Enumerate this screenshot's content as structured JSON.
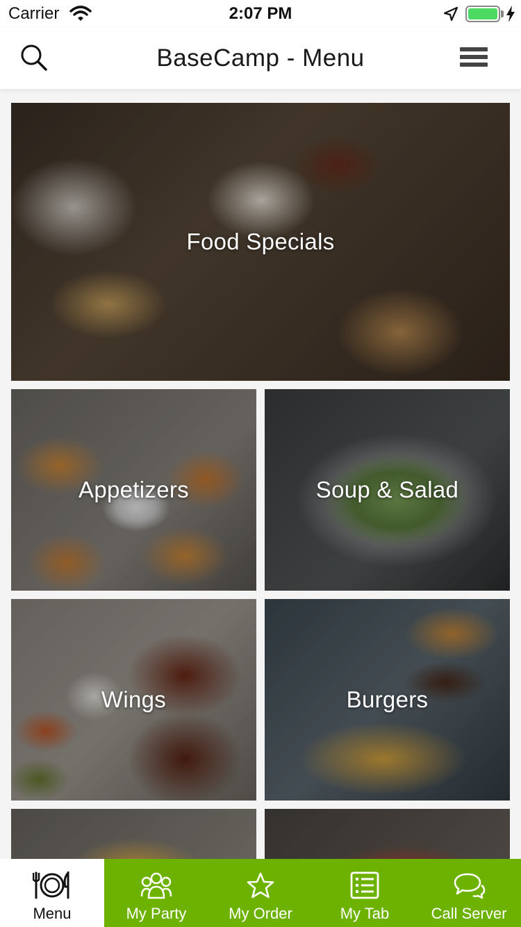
{
  "status_bar": {
    "carrier": "Carrier",
    "time": "2:07 PM",
    "battery_color": "#4cd964"
  },
  "navbar": {
    "title": "BaseCamp - Menu",
    "left_icon": "search-icon",
    "right_icon": "hamburger-menu-icon"
  },
  "categories": [
    {
      "label": "Food Specials"
    },
    {
      "label": "Appetizers"
    },
    {
      "label": "Soup & Salad"
    },
    {
      "label": "Wings"
    },
    {
      "label": "Burgers"
    },
    {
      "label": ""
    },
    {
      "label": ""
    }
  ],
  "tabbar": {
    "accent_color": "#6db200",
    "tabs": [
      {
        "label": "Menu",
        "icon": "plate-utensils-icon",
        "active": true
      },
      {
        "label": "My Party",
        "icon": "group-icon",
        "active": false
      },
      {
        "label": "My Order",
        "icon": "star-icon",
        "active": false
      },
      {
        "label": "My Tab",
        "icon": "list-icon",
        "active": false
      },
      {
        "label": "Call Server",
        "icon": "chat-bubbles-icon",
        "active": false
      }
    ]
  }
}
